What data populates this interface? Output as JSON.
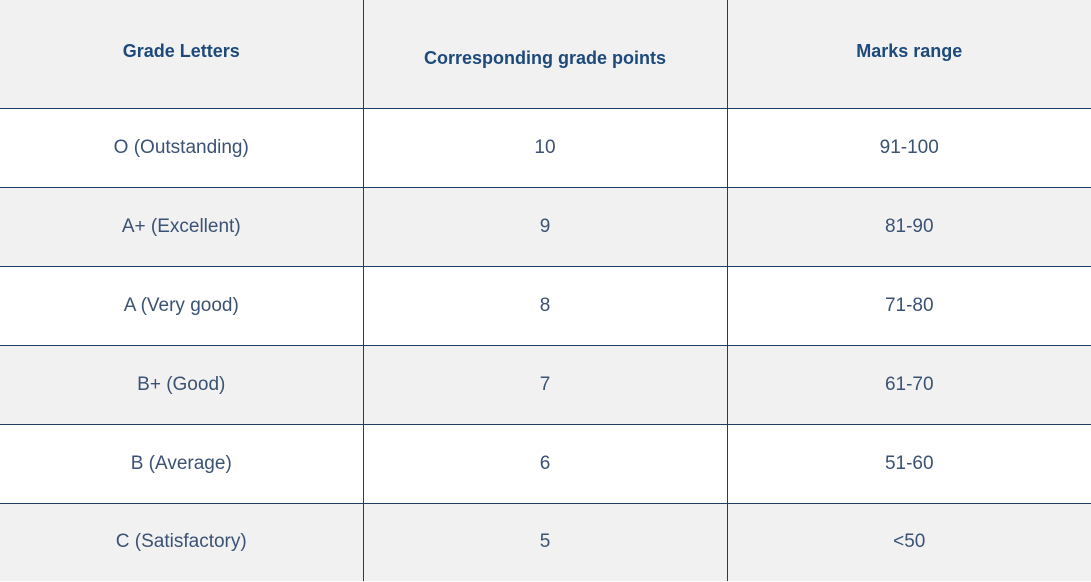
{
  "table": {
    "headers": [
      "Grade Letters",
      "Corresponding grade points",
      "Marks range"
    ],
    "rows": [
      [
        "O (Outstanding)",
        "10",
        "91-100"
      ],
      [
        "A+ (Excellent)",
        "9",
        "81-90"
      ],
      [
        "A (Very good)",
        "8",
        "71-80"
      ],
      [
        "B+ (Good)",
        "7",
        "61-70"
      ],
      [
        "B (Average)",
        "6",
        "51-60"
      ],
      [
        "C (Satisfactory)",
        "5",
        "<50"
      ]
    ]
  },
  "colors": {
    "header_text": "#1d4a7a",
    "body_text": "#3a5273",
    "border": "#1d3f66",
    "stripe": "#f1f1f2"
  }
}
